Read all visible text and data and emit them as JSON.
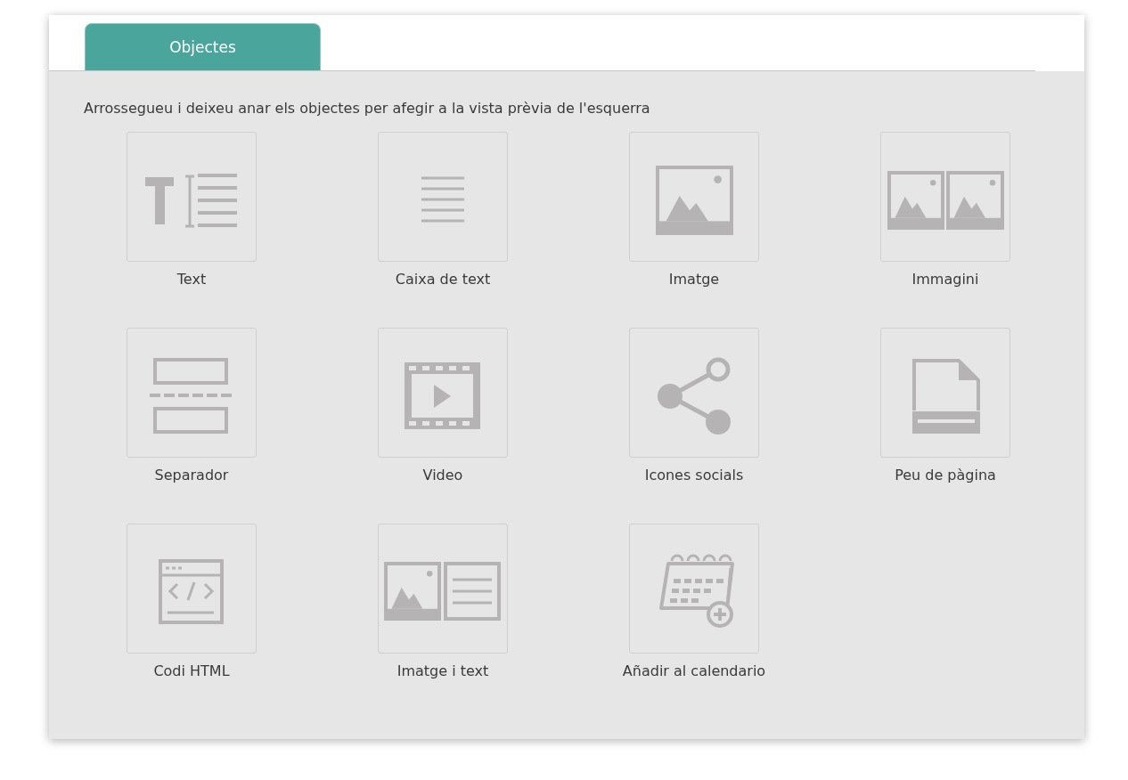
{
  "tabs": [
    {
      "label": "Objectes",
      "selected": true
    }
  ],
  "instruction": "Arrossegueu i deixeu anar els objectes per afegir a la vista prèvia de l'esquerra",
  "objects": [
    {
      "kind": "text",
      "label": "Text"
    },
    {
      "kind": "textbox",
      "label": "Caixa de text"
    },
    {
      "kind": "image",
      "label": "Imatge"
    },
    {
      "kind": "images",
      "label": "Immagini"
    },
    {
      "kind": "separator",
      "label": "Separador"
    },
    {
      "kind": "video",
      "label": "Video"
    },
    {
      "kind": "social",
      "label": "Icones socials"
    },
    {
      "kind": "footer",
      "label": "Peu de pàgina"
    },
    {
      "kind": "html",
      "label": "Codi HTML"
    },
    {
      "kind": "imagetext",
      "label": "Imatge i text"
    },
    {
      "kind": "calendar",
      "label": "Añadir al calendario"
    }
  ]
}
